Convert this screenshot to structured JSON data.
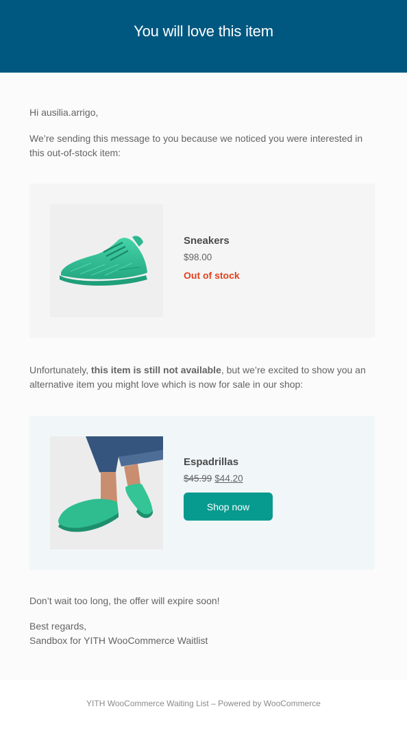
{
  "header": {
    "title": "You will love this item"
  },
  "email": {
    "greeting": "Hi ausilia.arrigo,",
    "intro": "We’re sending this message to you because we noticed you were interested in this out-of-stock item:",
    "oos_product": {
      "name": "Sneakers",
      "price": "$98.00",
      "stock_status": "Out of stock",
      "image_alt": "sneaker-image"
    },
    "unfortunately_prefix": "Unfortunately, ",
    "unfortunately_bold": "this item is still not available",
    "unfortunately_suffix": ", but we’re excited to show you an alternative item you might love which is now for sale in our shop:",
    "alt_product": {
      "name": "Espadrillas",
      "old_price": "$45.99",
      "new_price": "$44.20",
      "button_label": "Shop now"
    },
    "wait_text": "Don’t wait too long, the offer will expire soon!",
    "regards_line1": "Best regards,",
    "regards_line2": "Sandbox for YITH WooCommerce Waitlist"
  },
  "footer": {
    "text": "YITH WooCommerce Waiting List – Powered by WooCommerce"
  },
  "colors": {
    "header_bg": "#005880",
    "accent_button": "#079a8f",
    "out_of_stock": "#e2401c",
    "product_green": "#3ec9a0"
  }
}
